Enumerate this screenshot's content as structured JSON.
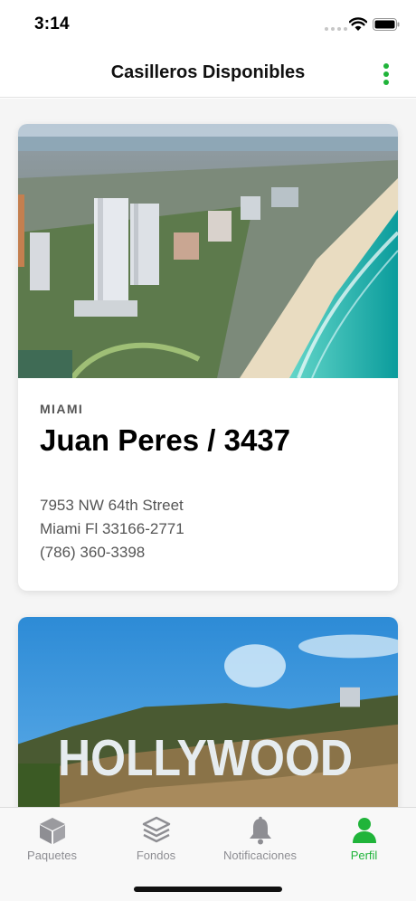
{
  "status_bar": {
    "time": "3:14"
  },
  "nav": {
    "title": "Casilleros Disponibles",
    "more_icon": "more-vertical-icon"
  },
  "accent_color": "#20b43a",
  "cards": [
    {
      "image": "miami-beach-aerial-photo",
      "city": "MIAMI",
      "name": "Juan Peres / 3437",
      "address_line1": "7953 NW 64th Street",
      "address_line2": "Miami Fl 33166-2771",
      "phone": "(786) 360-3398"
    },
    {
      "image": "hollywood-sign-photo",
      "sign_text": "HOLLYWOOD"
    }
  ],
  "tabs": [
    {
      "label": "Paquetes",
      "icon": "box-icon",
      "active": false
    },
    {
      "label": "Fondos",
      "icon": "layers-icon",
      "active": false
    },
    {
      "label": "Notificaciones",
      "icon": "bell-icon",
      "active": false
    },
    {
      "label": "Perfil",
      "icon": "user-icon",
      "active": true
    }
  ]
}
